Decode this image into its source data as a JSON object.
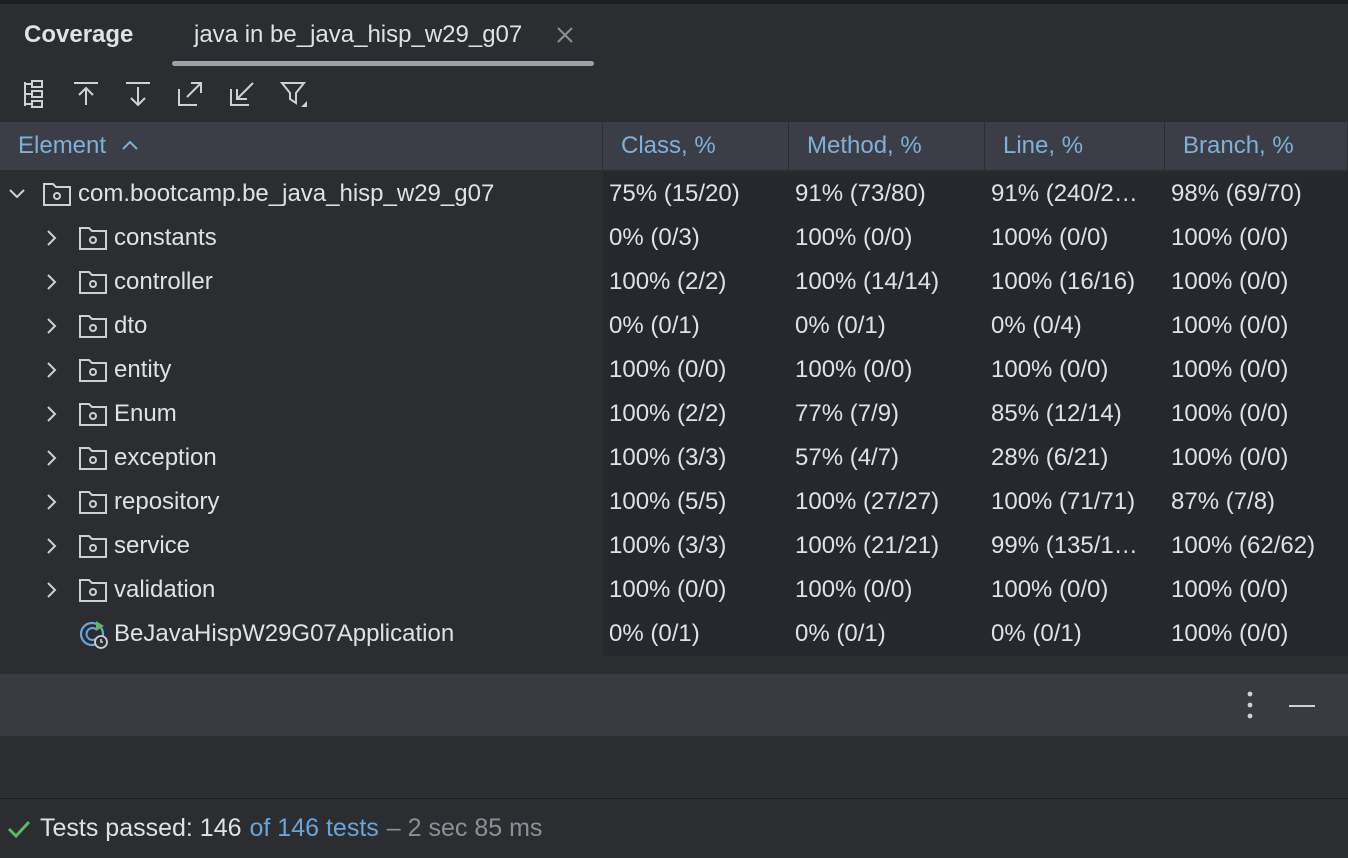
{
  "tool_window": {
    "title": "Coverage"
  },
  "tab": {
    "label": "java in be_java_hisp_w29_g07"
  },
  "toolbar": {
    "icons": [
      "flatten-packages-icon",
      "navigate-up-icon",
      "navigate-down-icon",
      "export-icon",
      "import-icon",
      "filter-icon"
    ]
  },
  "table": {
    "columns": [
      "Element",
      "Class, %",
      "Method, %",
      "Line, %",
      "Branch, %"
    ],
    "rows": [
      {
        "name": "com.bootcamp.be_java_hisp_w29_g07",
        "class": "75% (15/20)",
        "method": "91% (73/80)",
        "line": "91% (240/2…",
        "branch": "98% (69/70)"
      },
      {
        "name": "constants",
        "class": "0% (0/3)",
        "method": "100% (0/0)",
        "line": "100% (0/0)",
        "branch": "100% (0/0)"
      },
      {
        "name": "controller",
        "class": "100% (2/2)",
        "method": "100% (14/14)",
        "line": "100% (16/16)",
        "branch": "100% (0/0)"
      },
      {
        "name": "dto",
        "class": "0% (0/1)",
        "method": "0% (0/1)",
        "line": "0% (0/4)",
        "branch": "100% (0/0)"
      },
      {
        "name": "entity",
        "class": "100% (0/0)",
        "method": "100% (0/0)",
        "line": "100% (0/0)",
        "branch": "100% (0/0)"
      },
      {
        "name": "Enum",
        "class": "100% (2/2)",
        "method": "77% (7/9)",
        "line": "85% (12/14)",
        "branch": "100% (0/0)"
      },
      {
        "name": "exception",
        "class": "100% (3/3)",
        "method": "57% (4/7)",
        "line": "28% (6/21)",
        "branch": "100% (0/0)"
      },
      {
        "name": "repository",
        "class": "100% (5/5)",
        "method": "100% (27/27)",
        "line": "100% (71/71)",
        "branch": "87% (7/8)"
      },
      {
        "name": "service",
        "class": "100% (3/3)",
        "method": "100% (21/21)",
        "line": "99% (135/1…",
        "branch": "100% (62/62)"
      },
      {
        "name": "validation",
        "class": "100% (0/0)",
        "method": "100% (0/0)",
        "line": "100% (0/0)",
        "branch": "100% (0/0)"
      },
      {
        "name": "BeJavaHispW29G07Application",
        "class": "0% (0/1)",
        "method": "0% (0/1)",
        "line": "0% (0/1)",
        "branch": "100% (0/0)"
      }
    ]
  },
  "status": {
    "prefix": "Tests passed: 146",
    "link": "of 146 tests",
    "time": "– 2 sec 85 ms"
  },
  "colors": {
    "background": "#2b2d30",
    "header_bg": "#3b3e46",
    "header_text": "#7fb0d6",
    "success": "#5fb865",
    "link": "#6aa5d9"
  }
}
